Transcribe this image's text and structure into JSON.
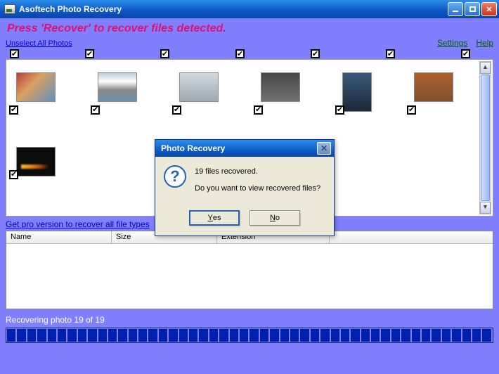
{
  "window": {
    "title": "Asoftech Photo Recovery"
  },
  "instruction": "Press 'Recover' to recover files detected.",
  "links": {
    "unselect": "Unselect All Photos",
    "settings": "Settings",
    "help": "Help",
    "pro": "Get pro version to recover all file types"
  },
  "table": {
    "col_name": "Name",
    "col_size": "Size",
    "col_ext": "Extension"
  },
  "status": "Recovering photo 19 of 19",
  "dialog": {
    "title": "Photo Recovery",
    "line1": "19 files recovered.",
    "line2": "Do you want to view recovered files?",
    "yes_u": "Y",
    "yes_rest": "es",
    "no_u": "N",
    "no_rest": "o"
  }
}
